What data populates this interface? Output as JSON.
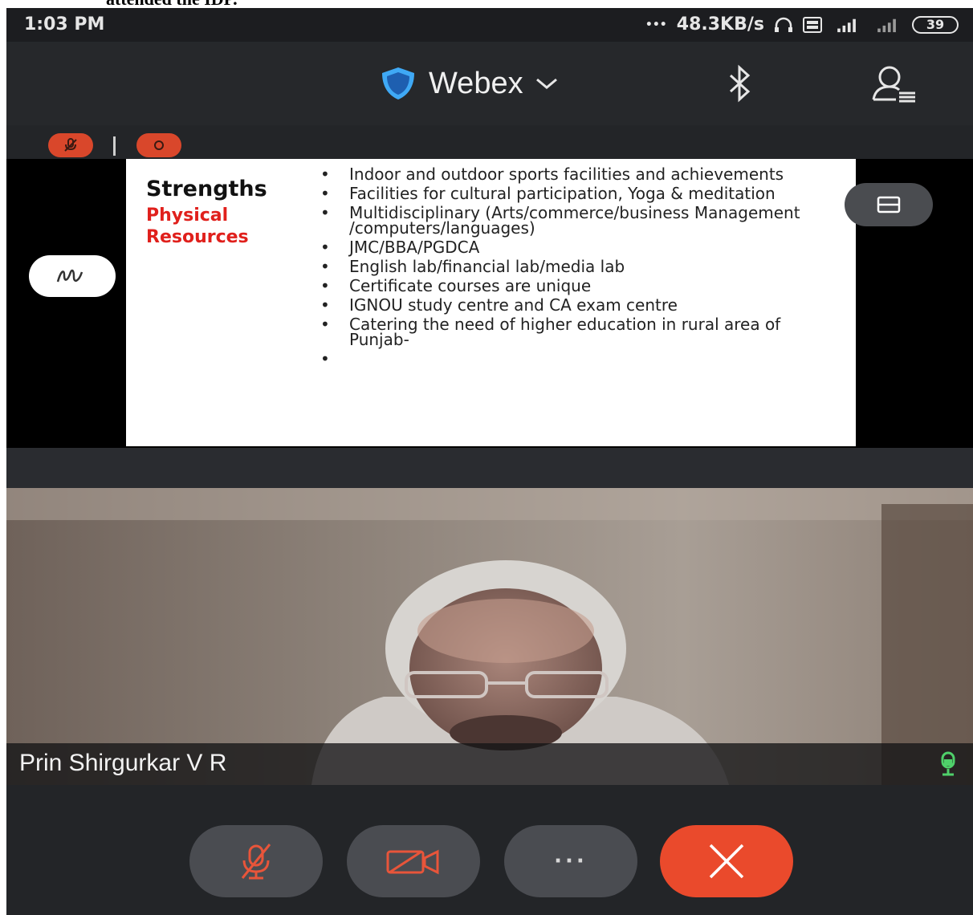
{
  "doc_caption": "attended the IDP.",
  "status_bar": {
    "time": "1:03 PM",
    "net_speed": "48.3KB/s",
    "battery": "39"
  },
  "header": {
    "title": "Webex",
    "icons": [
      "shield-icon",
      "chevron-down-icon",
      "bluetooth-icon",
      "participants-icon"
    ]
  },
  "toolbar": {
    "pills": [
      "muted-mic-icon",
      "recording-icon"
    ]
  },
  "slide": {
    "heading": "Strengths",
    "subheading": "Physical Resources",
    "bullets": [
      "Indoor and outdoor sports facilities and achievements",
      "Facilities for cultural participation, Yoga & meditation",
      "Multidisciplinary (Arts/commerce/business Management /computers/languages)",
      "JMC/BBA/PGDCA",
      "English lab/financial lab/media lab",
      "Certificate courses are unique",
      "IGNOU study centre and CA exam centre",
      "Catering the need of higher education in rural area of Punjab-",
      ""
    ]
  },
  "video": {
    "participant_name": "Prin Shirgurkar V R"
  },
  "controls": {
    "more_label": "···",
    "colors": {
      "end_call": "#ea4a2c",
      "accent_icon": "#e8553a",
      "mic_active": "#4fd06a"
    }
  }
}
